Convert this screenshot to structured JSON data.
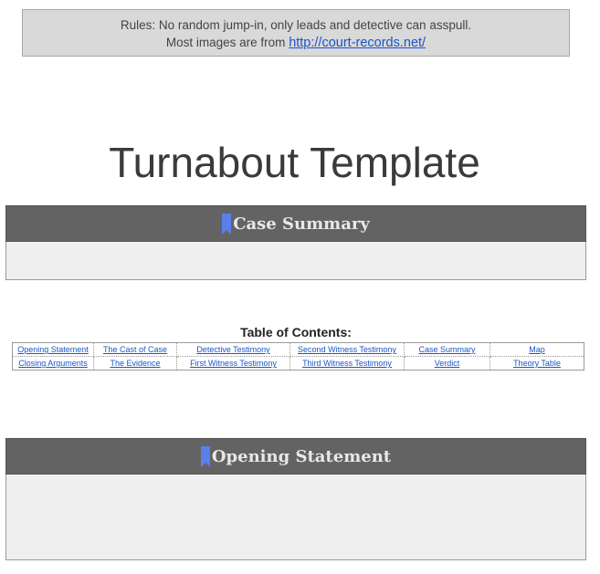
{
  "rules": {
    "line1": "Rules: No random jump-in, only leads and detective can asspull.",
    "line2_prefix": "Most images are from ",
    "link": "http://court-records.net/"
  },
  "page_title": "Turnabout Template",
  "sections": {
    "case_summary": {
      "title": "Case Summary"
    },
    "opening_statement": {
      "title": "Opening Statement"
    }
  },
  "toc": {
    "heading": "Table of Contents:",
    "row1": [
      "Opening Statement",
      "The Cast of Case",
      "Detective Testimony",
      "Second Witness Testimony",
      "Case Summary",
      "Map"
    ],
    "row2": [
      "Closing Arguments",
      "The Evidence",
      "First Witness Testimony",
      "Third Witness Testimony",
      "Verdict",
      "Theory Table"
    ]
  },
  "colors": {
    "header_bg": "#636363",
    "body_bg": "#efefef",
    "bookmark": "#5b7fe8",
    "link": "#1a56c9"
  },
  "icons": {
    "section_marker": "bookmark-icon"
  }
}
